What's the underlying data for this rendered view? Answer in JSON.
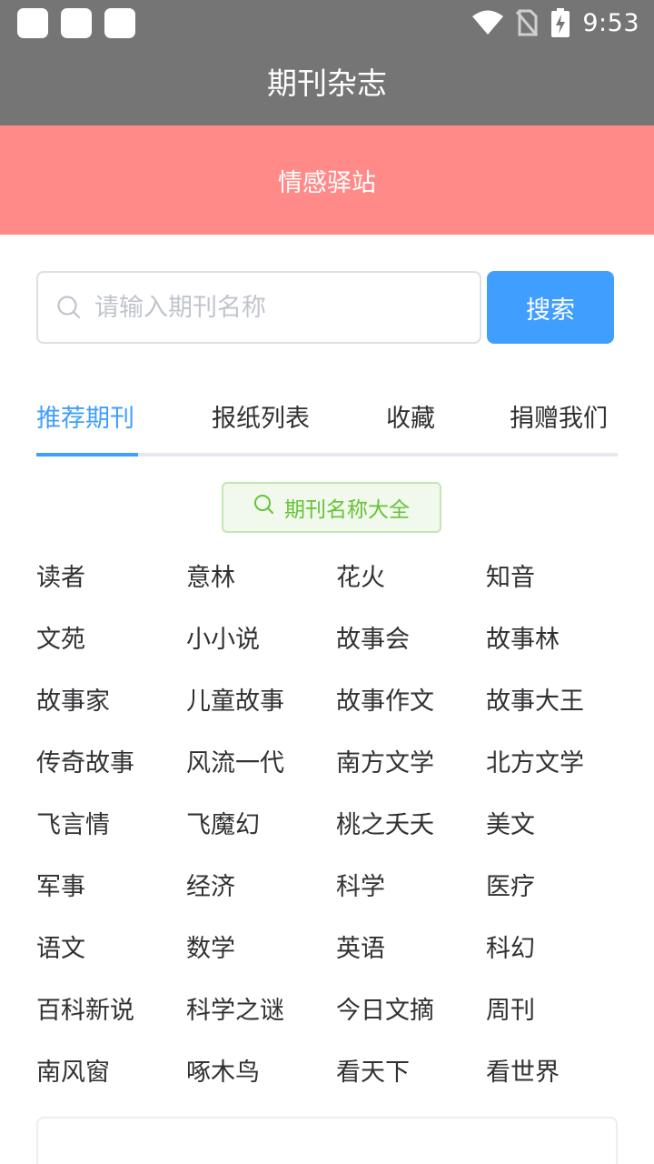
{
  "status_bar": {
    "time": "9:53",
    "icons": [
      "notification-square-icon",
      "notification-square-icon",
      "notification-square-icon",
      "wifi-icon",
      "no-sim-icon",
      "battery-charging-icon"
    ]
  },
  "app": {
    "title": "期刊杂志"
  },
  "banner": {
    "text": "情感驿站"
  },
  "search": {
    "placeholder": "请输入期刊名称",
    "button_label": "搜索",
    "icon": "search-icon"
  },
  "tabs": [
    {
      "label": "推荐期刊",
      "active": true
    },
    {
      "label": "报纸列表",
      "active": false
    },
    {
      "label": "收藏",
      "active": false
    },
    {
      "label": "捐赠我们",
      "active": false
    }
  ],
  "tag": {
    "label": "期刊名称大全",
    "icon": "search-icon"
  },
  "magazines": [
    [
      "读者",
      "意林",
      "花火",
      "知音"
    ],
    [
      "文苑",
      "小小说",
      "故事会",
      "故事林"
    ],
    [
      "故事家",
      "儿童故事",
      "故事作文",
      "故事大王"
    ],
    [
      "传奇故事",
      "风流一代",
      "南方文学",
      "北方文学"
    ],
    [
      "飞言情",
      "飞魔幻",
      "桃之夭夭",
      "美文"
    ],
    [
      "军事",
      "经济",
      "科学",
      "医疗"
    ],
    [
      "语文",
      "数学",
      "英语",
      "科幻"
    ],
    [
      "百科新说",
      "科学之谜",
      "今日文摘",
      "周刊"
    ],
    [
      "南风窗",
      "啄木鸟",
      "看天下",
      "看世界"
    ]
  ],
  "colors": {
    "status_bar": "#757575",
    "banner": "#ff8a88",
    "primary": "#409eff",
    "tag_text": "#67c23a",
    "tag_bg": "#f0f9eb"
  }
}
